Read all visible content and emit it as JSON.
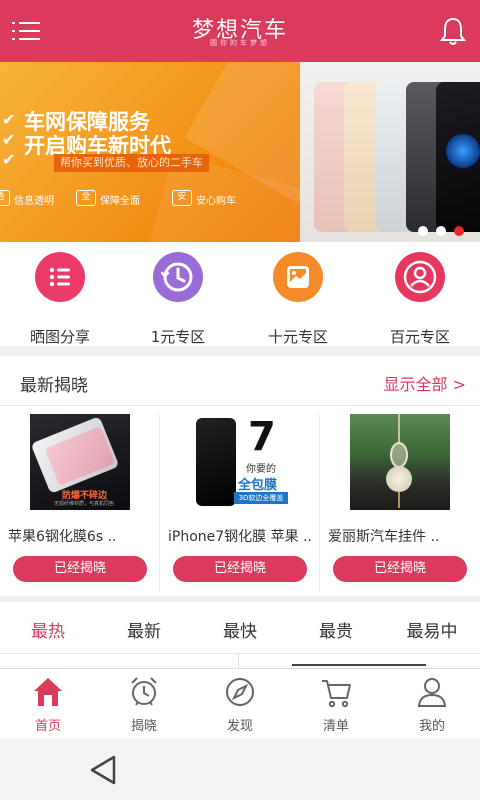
{
  "header": {
    "title": "梦想汽车",
    "subtitle": "圆你的车梦想",
    "menu_icon": "menu-icon",
    "bell_icon": "bell-icon"
  },
  "banner": {
    "headline_1": "车网保障服务",
    "headline_2": "开启购车新时代",
    "tagline": "帮你买到优质、放心的二手车",
    "features": [
      {
        "badge": "透",
        "label": "信息透明"
      },
      {
        "badge": "全",
        "label": "保障全面"
      },
      {
        "badge": "安",
        "label": "安心购车"
      }
    ],
    "slides_total": 3,
    "active_slide": 3
  },
  "categories": [
    {
      "label": "晒图分享",
      "icon": "list-icon",
      "color": "#ea3a6a"
    },
    {
      "label": "1元专区",
      "icon": "clock-icon",
      "color": "#9b6cd8"
    },
    {
      "label": "十元专区",
      "icon": "image-icon",
      "color": "#f48a28"
    },
    {
      "label": "百元专区",
      "icon": "user-icon",
      "color": "#e8375e"
    }
  ],
  "latest": {
    "title": "最新揭晓",
    "more": "显示全部 >",
    "products": [
      {
        "name": "苹果6钢化膜6s ..",
        "button": "已经揭晓",
        "img_text_1": "防爆不碎边",
        "img_text_2": "无损纤维材质，与真机同色"
      },
      {
        "name": "iPhone7钢化膜 苹果 ..",
        "button": "已经揭晓",
        "img_text_1": "你要的",
        "img_text_2": "全包膜",
        "img_text_3": "3D软边全覆盖"
      },
      {
        "name": "爱丽斯汽车挂件 ..",
        "button": "已经揭晓"
      }
    ]
  },
  "sort_tabs": [
    "最热",
    "最新",
    "最快",
    "最贵",
    "最易中"
  ],
  "active_sort": 0,
  "bottom_nav": [
    {
      "label": "首页",
      "icon": "home-icon"
    },
    {
      "label": "揭晓",
      "icon": "alarm-clock-icon"
    },
    {
      "label": "发现",
      "icon": "compass-icon"
    },
    {
      "label": "清单",
      "icon": "cart-icon"
    },
    {
      "label": "我的",
      "icon": "person-icon"
    }
  ],
  "active_nav": 0,
  "colors": {
    "brand": "#db3a5c",
    "banner_orange": "#f39a1f"
  }
}
